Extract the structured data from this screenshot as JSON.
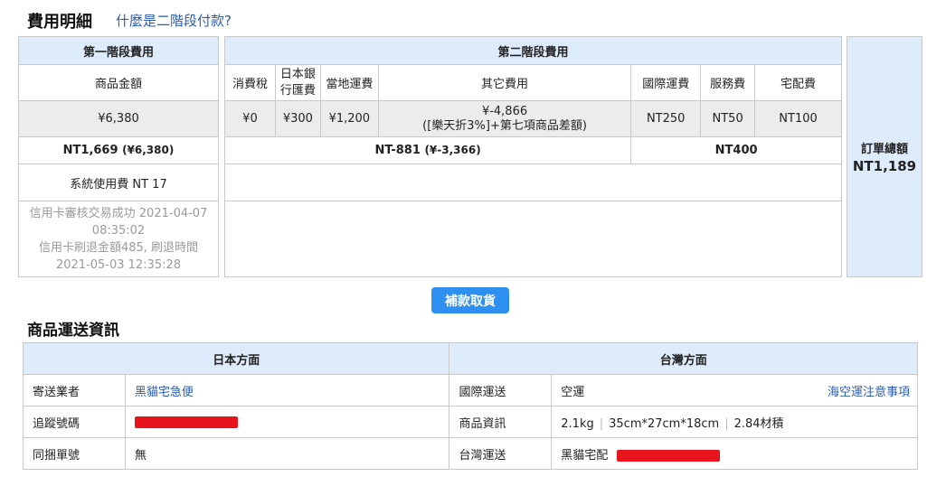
{
  "fee_section": {
    "title": "費用明細",
    "question_link": "什麼是二階段付款?"
  },
  "stage1": {
    "header": "第一階段費用",
    "col_label": "商品金額",
    "amount_jpy": "¥6,380",
    "total_main": "NT1,669",
    "total_sub": "(¥6,380)",
    "system_fee": "系統使用費 NT 17",
    "card_status_lines": [
      "信用卡審核交易成功 2021-04-07",
      "08:35:02",
      "信用卡刷退金額485, 刷退時間",
      "2021-05-03 12:35:28"
    ]
  },
  "stage2": {
    "header": "第二階段費用",
    "columns": [
      "消費稅",
      "日本銀行匯費",
      "當地運費",
      "其它費用",
      "國際運費",
      "服務費",
      "宅配費"
    ],
    "bank_fee_lines": [
      "日本銀",
      "行匯費"
    ],
    "values": {
      "tax": "¥0",
      "bank_fee": "¥300",
      "local_shipping": "¥1,200",
      "other_line1": "¥-4,866",
      "other_line2": "([樂天折3%]+第七項商品差額)",
      "intl_shipping": "NT250",
      "service_fee": "NT50",
      "delivery_fee": "NT100"
    },
    "subtotal_main": "NT-881",
    "subtotal_sub": "(¥-3,366)",
    "subtotal_nt": "NT400"
  },
  "order_total": {
    "label": "訂單總額",
    "value": "NT1,189"
  },
  "action_button": "補款取貨",
  "shipping_section": {
    "title": "商品運送資訊",
    "japan_header": "日本方面",
    "taiwan_header": "台灣方面",
    "rows": [
      {
        "jp_label": "寄送業者",
        "jp_value": "黑貓宅急便",
        "tw_label": "國際運送",
        "tw_value": "空運",
        "tw_link": "海空運注意事項"
      },
      {
        "jp_label": "追蹤號碼",
        "tw_label": "商品資訊",
        "tw_parts": [
          "2.1kg",
          "35cm*27cm*18cm",
          "2.84材積"
        ]
      },
      {
        "jp_label": "同捆單號",
        "jp_value": "無",
        "tw_label": "台灣運送",
        "tw_value": "黑貓宅配"
      }
    ]
  },
  "colors": {
    "header_bg": "#deebfb",
    "gray_bg": "#ececec",
    "button_bg": "#2d8ff0",
    "link": "#2a5db0",
    "redaction": "#e8141c"
  }
}
